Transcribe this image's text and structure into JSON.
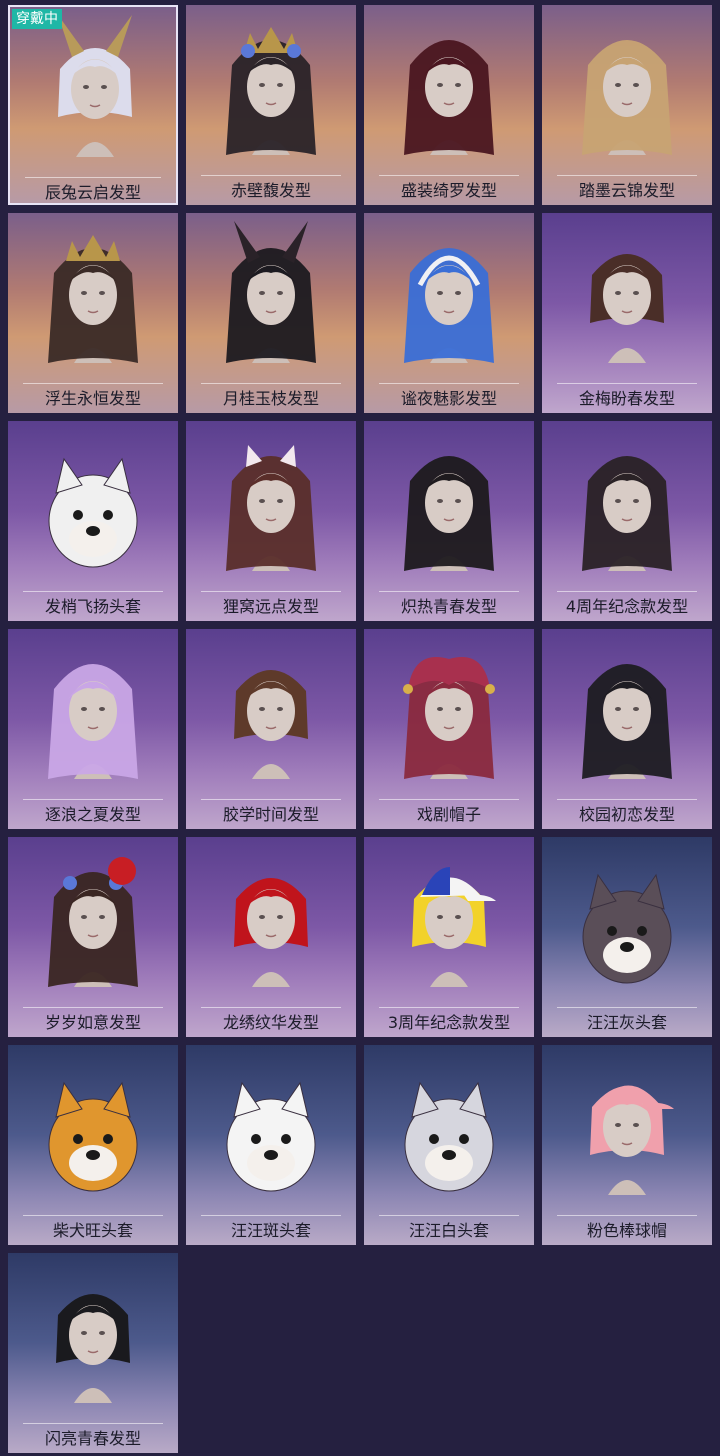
{
  "badge_text": "穿戴中",
  "items": [
    {
      "name": "辰兔云启发型",
      "art": "bunny-ears-white-hair-icon",
      "bg": "warm",
      "hair": "#dcdcec",
      "selected": true
    },
    {
      "name": "赤壁馥发型",
      "art": "flower-crown-dark-hair-icon",
      "bg": "warm",
      "hair": "#2a2328"
    },
    {
      "name": "盛装绮罗发型",
      "art": "long-red-hair-icon",
      "bg": "warm",
      "hair": "#4a1620"
    },
    {
      "name": "踏墨云锦发型",
      "art": "long-blonde-hair-icon",
      "bg": "warm",
      "hair": "#c7a373"
    },
    {
      "name": "浮生永恒发型",
      "art": "crown-long-brown-hair-icon",
      "bg": "warm",
      "hair": "#3a2a26"
    },
    {
      "name": "月桂玉枝发型",
      "art": "lace-bunny-ears-black-hair-icon",
      "bg": "warm",
      "hair": "#1c1a20"
    },
    {
      "name": "谧夜魅影发型",
      "art": "headphones-blue-curly-hair-icon",
      "bg": "warm",
      "hair": "#3a6ed6"
    },
    {
      "name": "金梅盼春发型",
      "art": "short-brown-hair-icon",
      "bg": "purple",
      "hair": "#4a2e28"
    },
    {
      "name": "发梢飞扬头套",
      "art": "unicorn-sunglasses-mask-icon",
      "bg": "purple",
      "hair": "#f0f0f0"
    },
    {
      "name": "狸窝远点发型",
      "art": "cat-ears-auburn-hair-icon",
      "bg": "purple",
      "hair": "#5a2e2a"
    },
    {
      "name": "炽热青春发型",
      "art": "ponytail-black-hair-icon",
      "bg": "purple",
      "hair": "#1e1a1e"
    },
    {
      "name": "4周年纪念款发型",
      "art": "starfish-clip-hair-icon",
      "bg": "purple",
      "hair": "#2a2226"
    },
    {
      "name": "逐浪之夏发型",
      "art": "lavender-ponytail-hair-icon",
      "bg": "purple",
      "hair": "#c9a6e6"
    },
    {
      "name": "胶学时间发型",
      "art": "brown-bob-hair-icon",
      "bg": "purple",
      "hair": "#5e3a2a"
    },
    {
      "name": "戏剧帽子",
      "art": "jester-hat-icon",
      "bg": "purple",
      "hair": "#8a2a3e"
    },
    {
      "name": "校园初恋发型",
      "art": "long-straight-black-hair-icon",
      "bg": "purple",
      "hair": "#1e1c22"
    },
    {
      "name": "岁岁如意发型",
      "art": "pigtails-red-flower-hair-icon",
      "bg": "purple",
      "hair": "#3a2622"
    },
    {
      "name": "龙绣纹华发型",
      "art": "red-bob-hair-icon",
      "bg": "purple",
      "hair": "#c0141c"
    },
    {
      "name": "3周年纪念款发型",
      "art": "baseball-cap-logo-icon",
      "bg": "purple",
      "hair": "#f2d22a"
    },
    {
      "name": "汪汪灰头套",
      "art": "husky-head-mask-icon",
      "bg": "blue",
      "hair": "#5a4e58"
    },
    {
      "name": "柴犬旺头套",
      "art": "shiba-head-mask-icon",
      "bg": "blue",
      "hair": "#e0962e"
    },
    {
      "name": "汪汪斑头套",
      "art": "dalmatian-head-mask-icon",
      "bg": "blue",
      "hair": "#f4f4f4"
    },
    {
      "name": "汪汪白头套",
      "art": "white-husky-mask-icon",
      "bg": "blue",
      "hair": "#d6d6de"
    },
    {
      "name": "粉色棒球帽",
      "art": "pink-baseball-cap-icon",
      "bg": "blue",
      "hair": "#f0a0ac"
    },
    {
      "name": "闪亮青春发型",
      "art": "short-black-bob-hair-icon",
      "bg": "blue",
      "hair": "#1a1a1e"
    }
  ]
}
